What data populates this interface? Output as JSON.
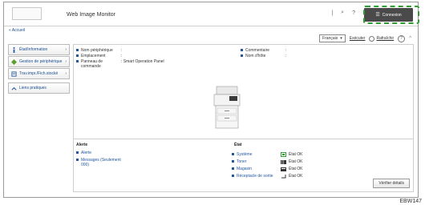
{
  "header": {
    "title": "Web Image Monitor",
    "search_glyph": "⌕",
    "help_glyph": "?",
    "login_label": "Connexion",
    "menu_glyph": "☰"
  },
  "breadcrumb": "« Accueil",
  "toolbar": {
    "language": "Français",
    "language_caret": "▾",
    "execute": "Exécuter",
    "refresh": "Rafraîchir",
    "help": "?",
    "collapse": "^"
  },
  "sidebar": {
    "items": [
      {
        "label": "État/Information",
        "icon": "info-icon",
        "arrow": "›"
      },
      {
        "label": "Gestion de périphérique",
        "icon": "device-management-icon",
        "arrow": "›"
      },
      {
        "label": "Trav.impr./Fich.stocké",
        "icon": "print-job-icon",
        "arrow": "›"
      },
      {
        "label": "Liens pratiques",
        "icon": "link-icon",
        "arrow": ""
      }
    ]
  },
  "info": {
    "device_name_label": "Nom périphérique",
    "device_name_value": ":",
    "location_label": "Emplacement",
    "location_value": ":",
    "panel_label": "Panneau de commande",
    "panel_value": ": Smart Operation Panel",
    "comment_label": "Commentaire",
    "comment_value": ":",
    "host_label": "Nom d'hôte",
    "host_value": ":"
  },
  "alert": {
    "title": "Alerte",
    "items": [
      "Alerte",
      "Messages (Seulement 000)"
    ]
  },
  "state": {
    "title": "État",
    "rows": [
      {
        "name": "Système",
        "value": "État OK",
        "icon": "system-icon",
        "color": "#2e9e2e"
      },
      {
        "name": "Toner",
        "value": "État OK",
        "icon": "toner-icon",
        "color": "#333333"
      },
      {
        "name": "Magasin",
        "value": "État OK",
        "icon": "tray-icon",
        "color": "#333333"
      },
      {
        "name": "Réceptacle de sortie",
        "value": "État OK",
        "icon": "output-tray-icon",
        "color": "#333333"
      }
    ]
  },
  "details_button": "Vérifier détails",
  "figure_code": "EBW147",
  "colors": {
    "accent": "#2456a0",
    "highlight": "#2e9e2e",
    "login_bg": "#4a4a4a"
  }
}
